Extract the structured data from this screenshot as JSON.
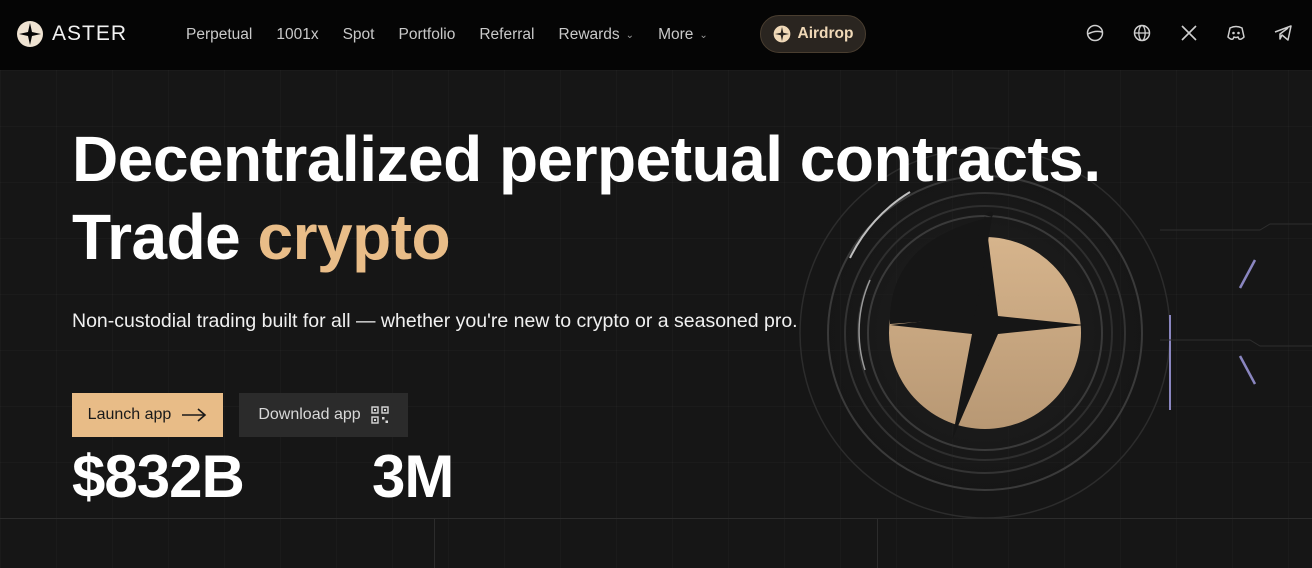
{
  "brand": {
    "name": "ASTER",
    "accent": "#e8bc87"
  },
  "nav": {
    "items": [
      {
        "label": "Perpetual",
        "dropdown": false
      },
      {
        "label": "1001x",
        "dropdown": false
      },
      {
        "label": "Spot",
        "dropdown": false
      },
      {
        "label": "Portfolio",
        "dropdown": false
      },
      {
        "label": "Referral",
        "dropdown": false
      },
      {
        "label": "Rewards",
        "dropdown": true
      },
      {
        "label": "More",
        "dropdown": true
      }
    ],
    "airdrop_label": "Airdrop",
    "socials": [
      "gitbook-icon",
      "globe-icon",
      "x-icon",
      "discord-icon",
      "telegram-icon"
    ]
  },
  "hero": {
    "headline_line1": "Decentralized perpetual contracts.",
    "headline_line2_prefix": "Trade ",
    "headline_line2_accent": "crypto",
    "subline": "Non-custodial trading built for all — whether you're new to crypto or a seasoned pro.",
    "launch_label": "Launch app",
    "download_label": "Download app",
    "stats": [
      "$832B",
      "3M"
    ]
  }
}
